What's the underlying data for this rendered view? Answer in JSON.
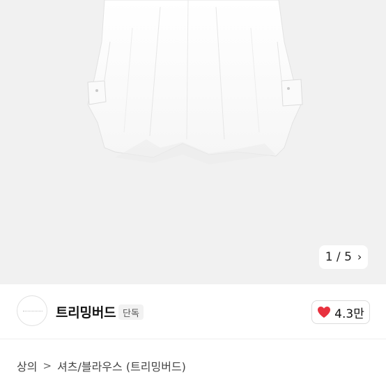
{
  "gallery": {
    "current": "1",
    "separator": "/",
    "total": "5",
    "next_icon": "chevron-right-icon"
  },
  "seller": {
    "name": "트리밍버드",
    "badge": "단독",
    "likes": "4.3만",
    "like_icon": "heart-icon",
    "like_color": "#e8313e"
  },
  "breadcrumb": {
    "level1": "상의",
    "separator_icon": "chevron-right-icon",
    "level2": "셔츠/블라우스 (트리밍버드)"
  }
}
